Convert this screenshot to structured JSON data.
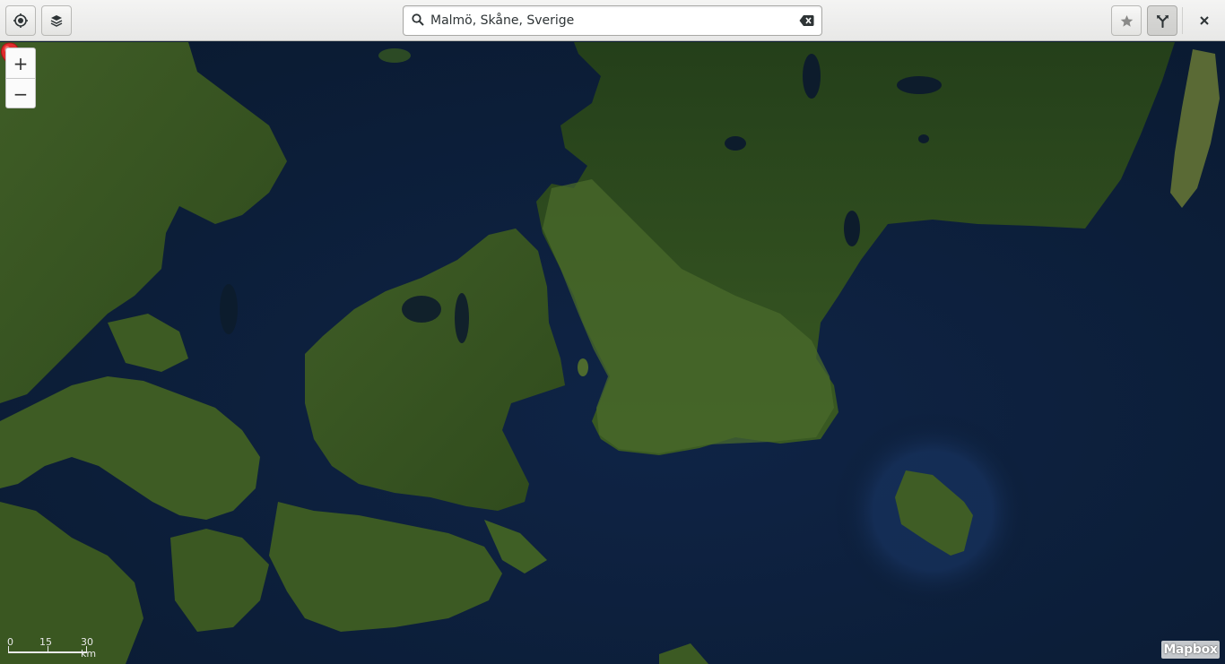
{
  "header": {
    "search_value": "Malmö, Skåne, Sverige",
    "buttons": [
      {
        "name": "current-location-button",
        "icon": "target-icon"
      },
      {
        "name": "layers-button",
        "icon": "layers-icon"
      },
      {
        "name": "favorites-button",
        "icon": "star-icon"
      },
      {
        "name": "route-button",
        "icon": "route-fork-icon",
        "active": true
      },
      {
        "name": "close-button",
        "icon": "close-icon"
      }
    ]
  },
  "map": {
    "zoom_in_label": "+",
    "zoom_out_label": "−",
    "scale": {
      "label_0": "0",
      "label_1": "15",
      "label_2": "30 km"
    },
    "attribution": "Mapbox",
    "marker_color": "#e02d2d",
    "location_dot_color": "#2b72c8"
  }
}
